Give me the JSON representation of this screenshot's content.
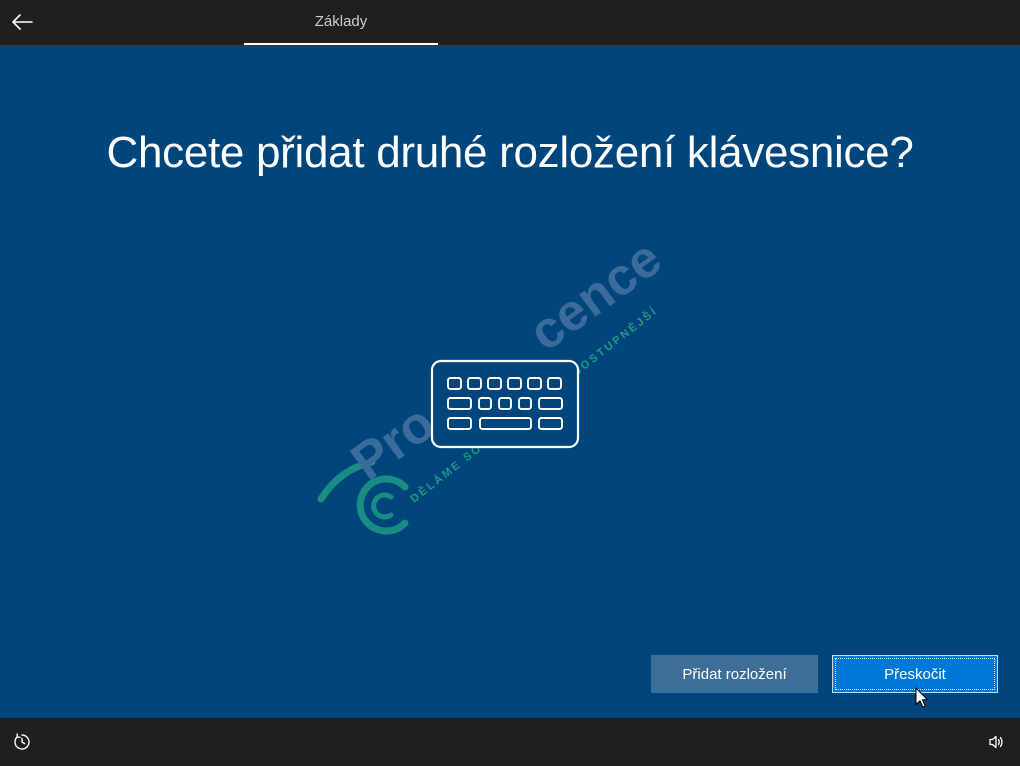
{
  "window": {
    "background_color": "#00457c"
  },
  "header": {
    "back_icon": "back-arrow-icon",
    "active_tab": "Základy",
    "background_color": "#1f1f1f"
  },
  "main": {
    "title": "Chcete přidat druhé rozložení klávesnice?",
    "illustration_icon": "keyboard-icon"
  },
  "actions": {
    "add_layout": {
      "label": "Přidat rozložení",
      "color": "#3d6e98"
    },
    "skip": {
      "label": "Přeskočit",
      "color": "#0078d7",
      "focused": true
    }
  },
  "footer": {
    "left_icon": "ease-of-access-icon",
    "right_icon": "volume-icon",
    "background_color": "#1f1f1f"
  },
  "watermark": {
    "brand_visible_parts": [
      "Pro",
      "cence"
    ],
    "tagline_visible_parts": [
      "DĚLÁME SOFT",
      "DOSTUPNĚJŠÍ"
    ],
    "brand_color": "#3a6b9b",
    "tagline_color": "#1f9a85"
  },
  "cursor": {
    "icon": "mouse-pointer-icon"
  }
}
